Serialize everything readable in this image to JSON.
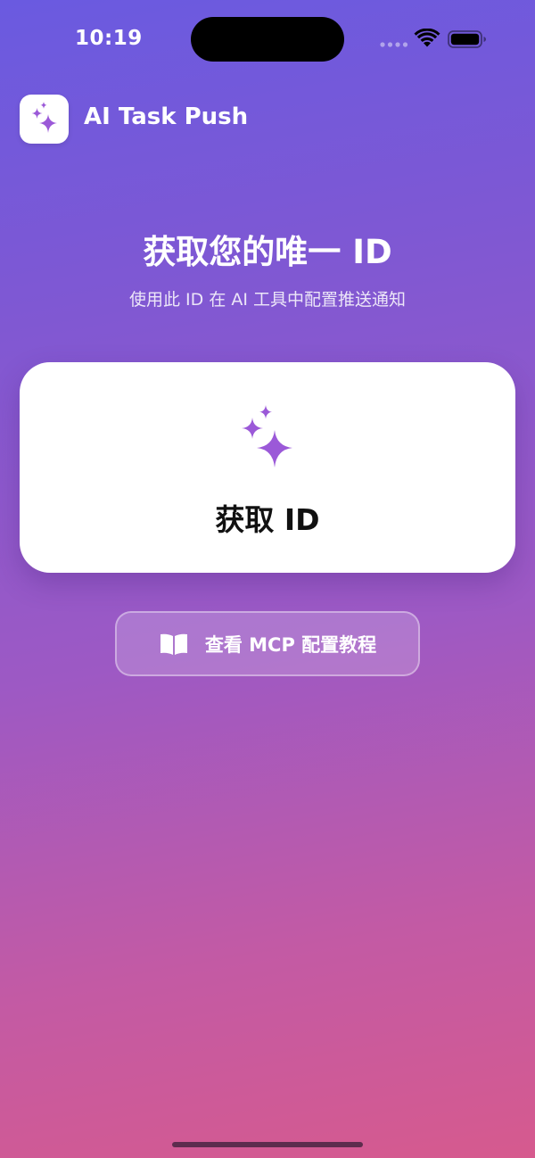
{
  "status_bar": {
    "time": "10:19"
  },
  "header": {
    "app_name": "AI Task Push",
    "app_icon": "sparkles-icon"
  },
  "main": {
    "title": "获取您的唯一 ID",
    "subtitle": "使用此 ID 在 AI 工具中配置推送通知",
    "get_id_card": {
      "label": "获取 ID",
      "icon": "sparkles-icon"
    },
    "tutorial_button": {
      "label": "查看 MCP 配置教程",
      "icon": "book-icon"
    }
  },
  "colors": {
    "gradient_top": "#6a5ae0",
    "gradient_bottom": "#d65a8e",
    "accent_purple": "#9b59d8",
    "card_background": "#ffffff"
  }
}
